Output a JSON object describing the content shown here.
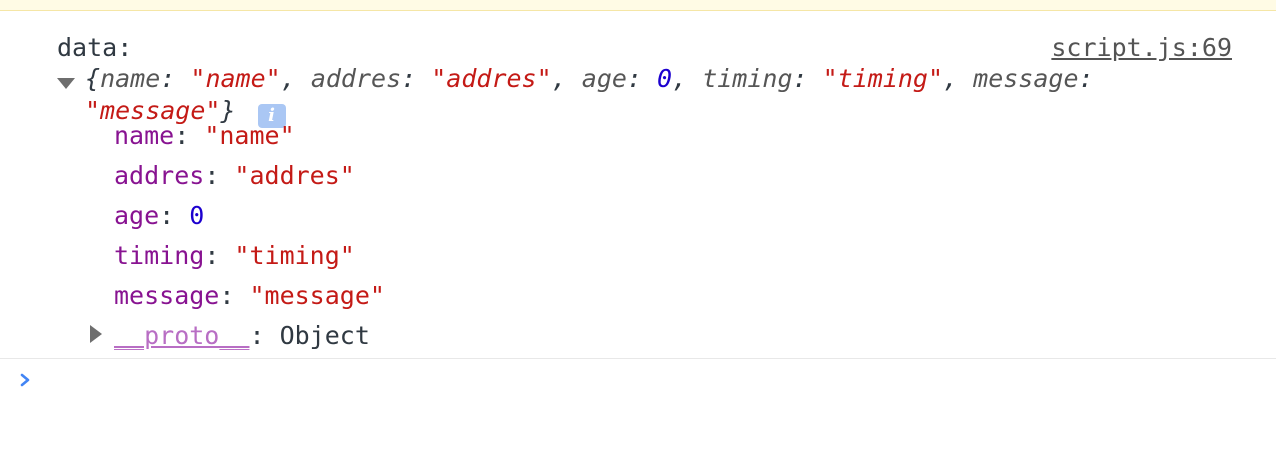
{
  "message": {
    "label": "data:",
    "source": "script.js:69",
    "summary": {
      "open_brace": "{",
      "k_name": "name",
      "v_name": "\"name\"",
      "k_addres": "addres",
      "v_addres": "\"addres\"",
      "k_age": "age",
      "v_age": "0",
      "k_timing": "timing",
      "v_timing": "\"timing\"",
      "k_message": "message",
      "v_message": "\"message\"",
      "close_brace": "}",
      "info_badge": "i"
    },
    "properties": [
      {
        "key": "name",
        "value": "\"name\"",
        "type": "string"
      },
      {
        "key": "addres",
        "value": "\"addres\"",
        "type": "string"
      },
      {
        "key": "age",
        "value": "0",
        "type": "number"
      },
      {
        "key": "timing",
        "value": "\"timing\"",
        "type": "string"
      },
      {
        "key": "message",
        "value": "\"message\"",
        "type": "string"
      }
    ],
    "proto": {
      "key": "__proto__",
      "value": "Object"
    }
  },
  "prompt": {
    "icon": "chevron-right-icon",
    "value": ""
  },
  "colors": {
    "string": "#c41a16",
    "number": "#1c00cf",
    "key": "#881391",
    "proto_key": "#b86ec4",
    "prompt_accent": "#4285f4"
  }
}
